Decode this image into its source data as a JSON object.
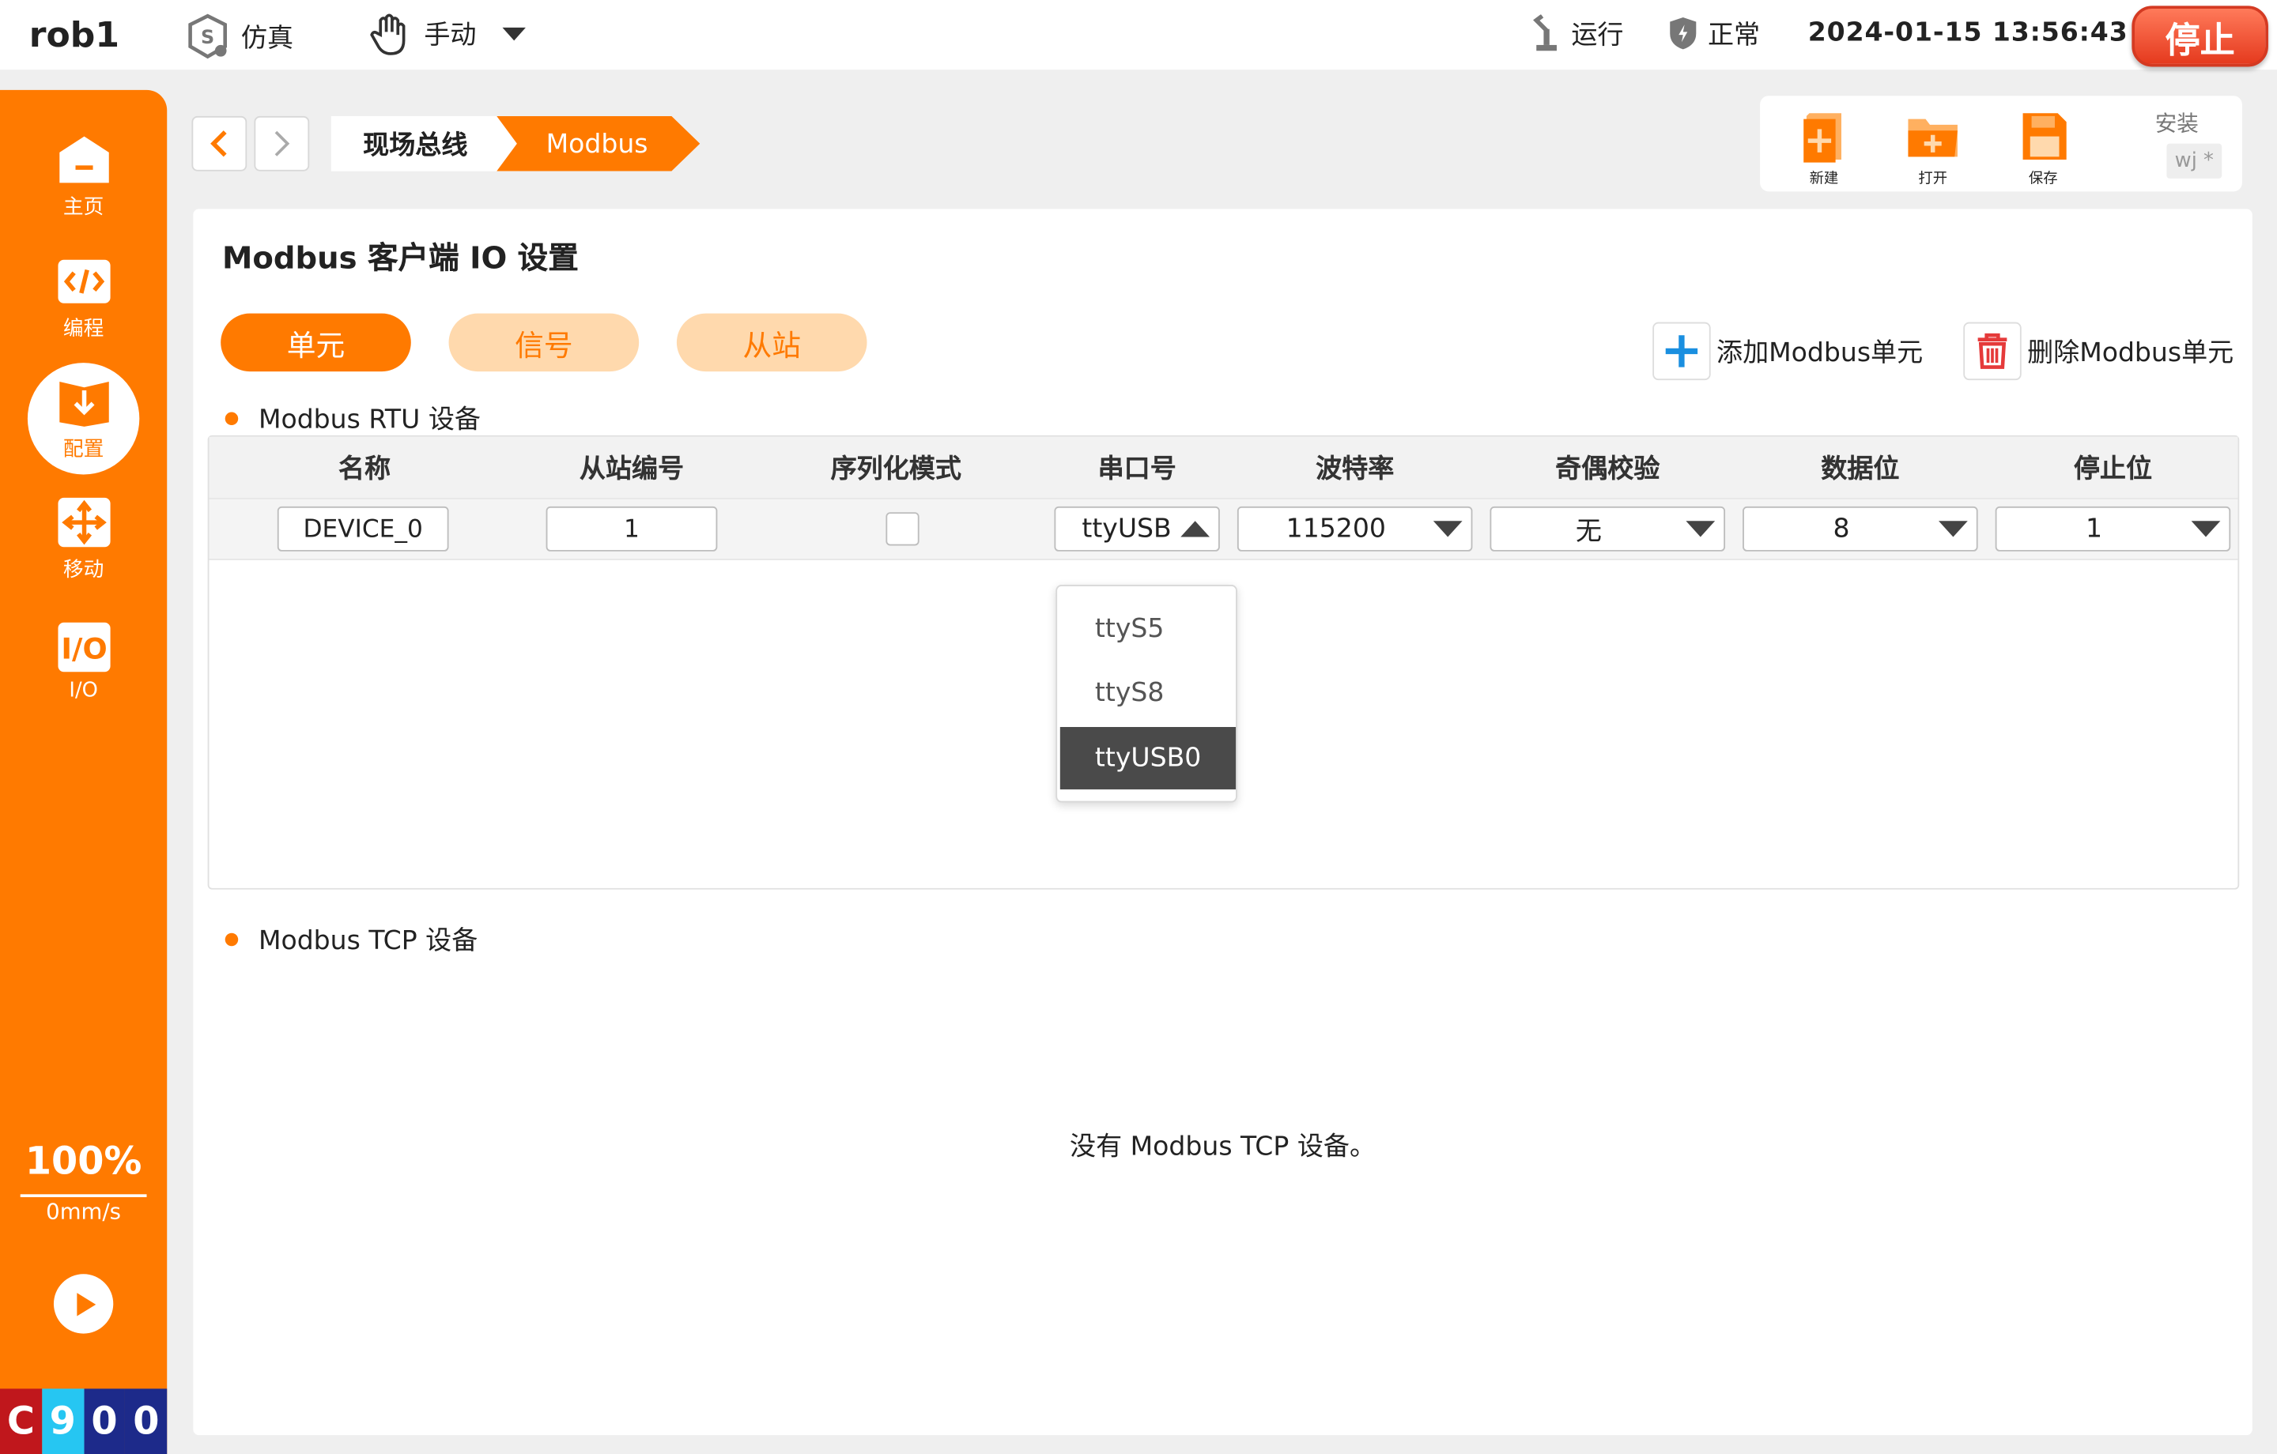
{
  "topbar": {
    "robot_name": "rob1",
    "sim_label": "仿真",
    "mode_label": "手动",
    "run_label": "运行",
    "status_label": "正常",
    "datetime": "2024-01-15 13:56:43",
    "stop_label": "停止"
  },
  "sidebar": {
    "items": [
      {
        "label": "主页",
        "icon": "home-icon"
      },
      {
        "label": "编程",
        "icon": "code-icon"
      },
      {
        "label": "配置",
        "icon": "config-icon"
      },
      {
        "label": "移动",
        "icon": "move-icon"
      },
      {
        "label": "I/O",
        "icon": "io-icon"
      }
    ],
    "speed_pct": "100%",
    "speed_val": "0mm/s",
    "counter": [
      "C",
      "9",
      "0",
      "0"
    ]
  },
  "breadcrumb": {
    "items": [
      "现场总线",
      "Modbus"
    ]
  },
  "filebar": {
    "new_label": "新建",
    "open_label": "打开",
    "save_label": "保存",
    "install_label": "安装",
    "project_label": "wj *"
  },
  "panel": {
    "title": "Modbus 客户端 IO 设置",
    "tabs": [
      "单元",
      "信号",
      "从站"
    ],
    "add_label": "添加Modbus单元",
    "del_label": "删除Modbus单元",
    "rtu_heading": "Modbus RTU 设备",
    "tcp_heading": "Modbus TCP 设备",
    "tcp_empty": "没有 Modbus TCP 设备。",
    "columns": [
      "名称",
      "从站编号",
      "序列化模式",
      "串口号",
      "波特率",
      "奇偶校验",
      "数据位",
      "停止位"
    ],
    "row": {
      "name": "DEVICE_0",
      "slave_id": "1",
      "port": "ttyUSB0",
      "baud": "115200",
      "parity": "无",
      "data_bits": "8",
      "stop_bits": "1"
    },
    "port_options": [
      "ttyS5",
      "ttyS8",
      "ttyUSB0"
    ]
  },
  "colors": {
    "accent": "#ff7a00",
    "accent_light": "#ffd9ad",
    "stop": "#e53a1e"
  }
}
